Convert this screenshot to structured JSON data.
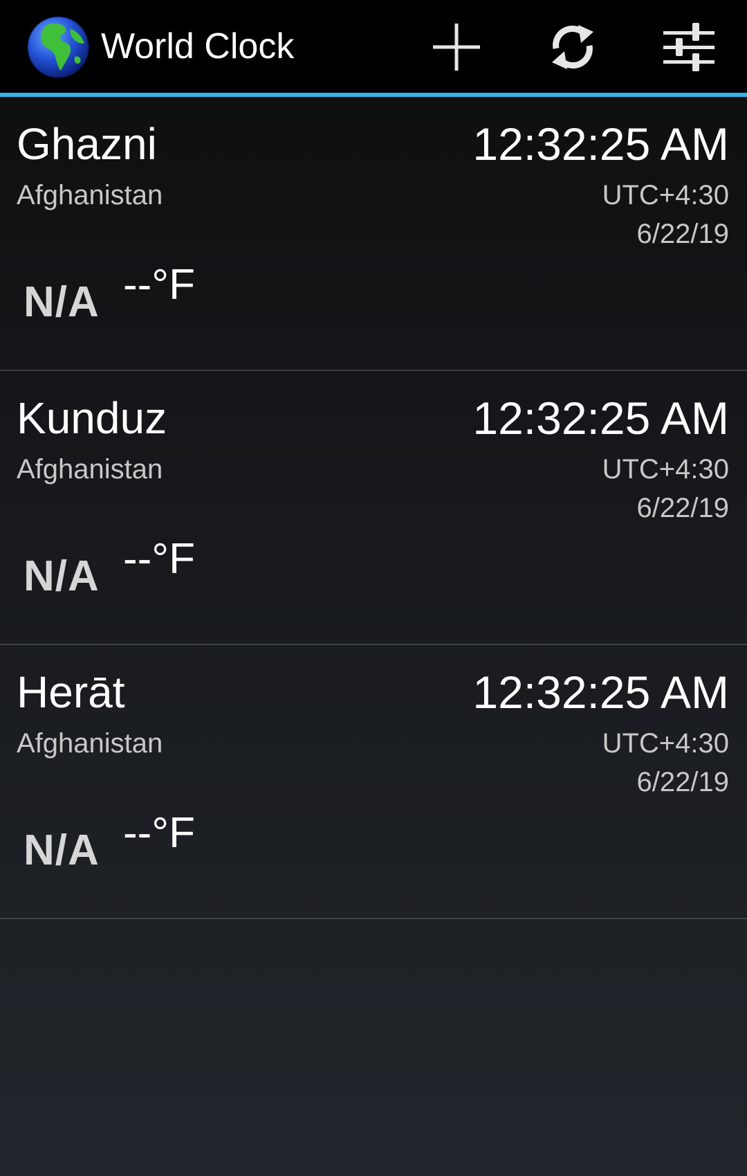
{
  "action_bar": {
    "title": "World Clock",
    "app_icon": "globe-icon",
    "actions": [
      {
        "name": "add",
        "icon": "plus-icon"
      },
      {
        "name": "refresh",
        "icon": "refresh-icon"
      },
      {
        "name": "settings",
        "icon": "sliders-icon"
      }
    ],
    "accent_color": "#33b5e5"
  },
  "clocks": [
    {
      "city": "Ghazni",
      "country": "Afghanistan",
      "time": "12:32:25 AM",
      "utc_offset": "UTC+4:30",
      "date": "6/22/19",
      "weather_icon_text": "N/A",
      "temperature": "--°F"
    },
    {
      "city": "Kunduz",
      "country": "Afghanistan",
      "time": "12:32:25 AM",
      "utc_offset": "UTC+4:30",
      "date": "6/22/19",
      "weather_icon_text": "N/A",
      "temperature": "--°F"
    },
    {
      "city": "Herāt",
      "country": "Afghanistan",
      "time": "12:32:25 AM",
      "utc_offset": "UTC+4:30",
      "date": "6/22/19",
      "weather_icon_text": "N/A",
      "temperature": "--°F"
    }
  ]
}
